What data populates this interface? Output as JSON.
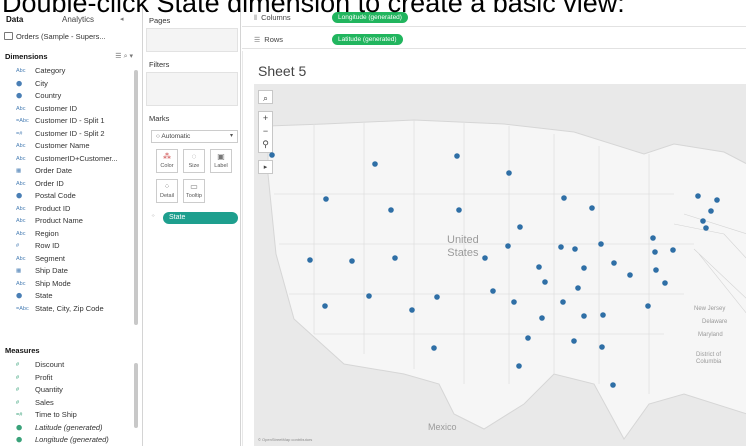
{
  "caption": "Double-click State dimension to create a basic view:",
  "left_pane": {
    "tab_data": "Data",
    "tab_analytics": "Analytics",
    "source_name": "Orders (Sample - Supers...",
    "dimensions_header": "Dimensions",
    "measures_header": "Measures",
    "dimensions": [
      {
        "icon": "Abc",
        "name": "Category"
      },
      {
        "icon": "⬤",
        "name": "City"
      },
      {
        "icon": "⬤",
        "name": "Country"
      },
      {
        "icon": "Abc",
        "name": "Customer ID"
      },
      {
        "icon": "=Abc",
        "name": "Customer ID - Split 1"
      },
      {
        "icon": "=#",
        "name": "Customer ID - Split 2"
      },
      {
        "icon": "Abc",
        "name": "Customer Name"
      },
      {
        "icon": "Abc",
        "name": "CustomerID+Customer..."
      },
      {
        "icon": "▦",
        "name": "Order Date"
      },
      {
        "icon": "Abc",
        "name": "Order ID"
      },
      {
        "icon": "⬤",
        "name": "Postal Code"
      },
      {
        "icon": "Abc",
        "name": "Product ID"
      },
      {
        "icon": "Abc",
        "name": "Product Name"
      },
      {
        "icon": "Abc",
        "name": "Region"
      },
      {
        "icon": "#",
        "name": "Row ID"
      },
      {
        "icon": "Abc",
        "name": "Segment"
      },
      {
        "icon": "▦",
        "name": "Ship Date"
      },
      {
        "icon": "Abc",
        "name": "Ship Mode"
      },
      {
        "icon": "⬤",
        "name": "State"
      },
      {
        "icon": "=Abc",
        "name": "State, City, Zip Code"
      }
    ],
    "measures": [
      {
        "icon": "#",
        "name": "Discount",
        "italic": false
      },
      {
        "icon": "#",
        "name": "Profit",
        "italic": false
      },
      {
        "icon": "#",
        "name": "Quantity",
        "italic": false
      },
      {
        "icon": "#",
        "name": "Sales",
        "italic": false
      },
      {
        "icon": "=#",
        "name": "Time to Ship",
        "italic": false
      },
      {
        "icon": "⬤",
        "name": "Latitude (generated)",
        "italic": true
      },
      {
        "icon": "⬤",
        "name": "Longitude (generated)",
        "italic": true
      }
    ]
  },
  "cards": {
    "pages": "Pages",
    "filters": "Filters",
    "marks": "Marks",
    "mark_type": "Automatic",
    "buttons": {
      "color": "Color",
      "size": "Size",
      "label": "Label",
      "detail": "Detail",
      "tooltip": "Tooltip"
    },
    "detail_pill": "State"
  },
  "shelves": {
    "columns_label": "Columns",
    "columns_pill": "Longitude (generated)",
    "rows_label": "Rows",
    "rows_pill": "Latitude (generated)"
  },
  "viz": {
    "sheet_title": "Sheet 5",
    "country_label_1": "United",
    "country_label_2": "States",
    "mexico_label": "Mexico",
    "place_labels": [
      "New Jersey",
      "Delaware",
      "Maryland",
      "District of Columbia"
    ],
    "attribution": "© OpenStreetMap contributors",
    "mark_color": "#2f6fa6"
  }
}
